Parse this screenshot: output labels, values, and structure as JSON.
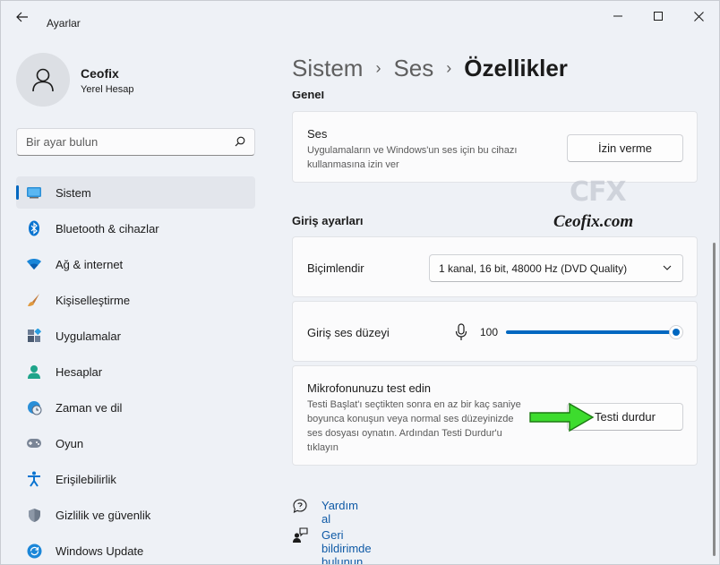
{
  "window": {
    "title": "Ayarlar",
    "controls": {
      "minimize": "minimize-icon",
      "maximize": "maximize-icon",
      "close": "close-icon"
    }
  },
  "profile": {
    "name": "Ceofix",
    "subtitle": "Yerel Hesap"
  },
  "search": {
    "placeholder": "Bir ayar bulun"
  },
  "sidebar": {
    "items": [
      {
        "label": "Sistem",
        "icon": "system-icon",
        "active": true
      },
      {
        "label": "Bluetooth & cihazlar",
        "icon": "bluetooth-icon"
      },
      {
        "label": "Ağ & internet",
        "icon": "wifi-icon"
      },
      {
        "label": "Kişiselleştirme",
        "icon": "brush-icon"
      },
      {
        "label": "Uygulamalar",
        "icon": "apps-icon"
      },
      {
        "label": "Hesaplar",
        "icon": "account-icon"
      },
      {
        "label": "Zaman ve dil",
        "icon": "time-language-icon"
      },
      {
        "label": "Oyun",
        "icon": "gaming-icon"
      },
      {
        "label": "Erişilebilirlik",
        "icon": "accessibility-icon"
      },
      {
        "label": "Gizlilik ve güvenlik",
        "icon": "shield-icon"
      },
      {
        "label": "Windows Update",
        "icon": "windows-update-icon"
      }
    ]
  },
  "breadcrumb": {
    "items": [
      "Sistem",
      "Ses"
    ],
    "separator": "›",
    "current": "Özellikler"
  },
  "general": {
    "section_title": "Genel",
    "ses": {
      "title": "Ses",
      "desc_line1": "Uygulamaların ve Windows'un ses için bu cihazı",
      "desc_line2": "kullanmasına izin ver",
      "button": "İzin verme"
    }
  },
  "input_settings": {
    "section_title": "Giriş ayarları",
    "format": {
      "label": "Biçimlendir",
      "value": "1 kanal, 16 bit, 48000 Hz (DVD Quality)"
    },
    "volume": {
      "label": "Giriş ses düzeyi",
      "value": "100",
      "level": 1.0
    },
    "test": {
      "title": "Mikrofonunuzu test edin",
      "desc_line1": "Testi Başlat'ı seçtikten sonra en az bir kaç saniye",
      "desc_line2": "boyunca konuşun veya normal ses düzeyinizde",
      "desc_line3": "ses dosyası oynatın. Ardından Testi Durdur'u",
      "desc_line4": "tıklayın",
      "button": "Testi durdur"
    }
  },
  "links": [
    {
      "label": "Yardım al",
      "icon": "help-icon"
    },
    {
      "label": "Geri bildirimde bulunun",
      "icon": "feedback-icon"
    }
  ],
  "watermark": {
    "logo": "CFX",
    "text": "Ceofix.com"
  },
  "colors": {
    "accent": "#0067c0",
    "link": "#0f5aa6",
    "arrow": "#3ddc2e"
  }
}
